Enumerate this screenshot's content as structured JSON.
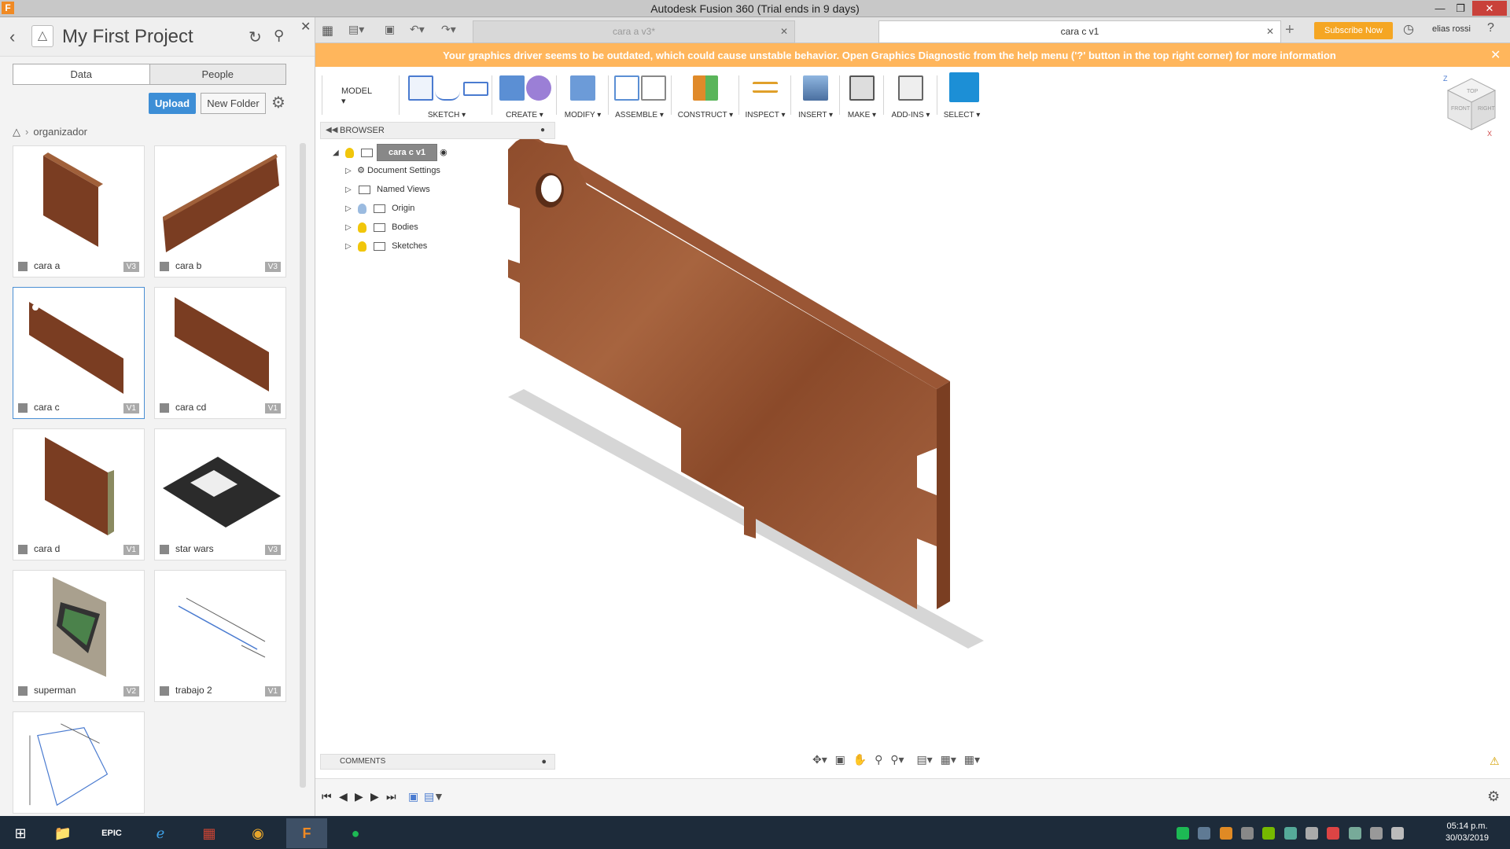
{
  "window": {
    "title": "Autodesk Fusion 360 (Trial ends in 9 days)",
    "app_icon": "F"
  },
  "data_panel": {
    "project_title": "My First Project",
    "tabs": [
      "Data",
      "People"
    ],
    "upload_label": "Upload",
    "new_folder_label": "New Folder",
    "breadcrumb": "organizador",
    "items": [
      {
        "name": "cara a",
        "version": "V3"
      },
      {
        "name": "cara b",
        "version": "V3"
      },
      {
        "name": "cara c",
        "version": "V1"
      },
      {
        "name": "cara cd",
        "version": "V1"
      },
      {
        "name": "cara d",
        "version": "V1"
      },
      {
        "name": "star wars",
        "version": "V3"
      },
      {
        "name": "superman",
        "version": "V2"
      },
      {
        "name": "trabajo 2",
        "version": "V1"
      },
      {
        "name": "",
        "version": ""
      }
    ]
  },
  "app_tabs": {
    "inactive_tab": "cara a v3*",
    "active_tab": "cara c v1",
    "subscribe": "Subscribe Now",
    "user": "elias rossi"
  },
  "banner": {
    "message": "Your graphics driver seems to be outdated, which could cause unstable behavior. Open Graphics Diagnostic from the help menu ('?' button in the top right corner) for more information"
  },
  "toolbar": {
    "workspace": "MODEL",
    "groups": [
      "SKETCH",
      "CREATE",
      "MODIFY",
      "ASSEMBLE",
      "CONSTRUCT",
      "INSPECT",
      "INSERT",
      "MAKE",
      "ADD-INS",
      "SELECT"
    ]
  },
  "browser": {
    "title": "BROWSER",
    "root": "cara c v1",
    "nodes": [
      "Document Settings",
      "Named Views",
      "Origin",
      "Bodies",
      "Sketches"
    ]
  },
  "comments_label": "COMMENTS",
  "viewcube": {
    "top": "TOP",
    "front": "FRONT",
    "right": "RIGHT",
    "axis_z": "Z",
    "axis_x": "X"
  },
  "taskbar": {
    "time": "05:14 p.m.",
    "date": "30/03/2019"
  },
  "colors": {
    "accent_blue": "#3d8ed6",
    "banner_orange": "#ffb65c",
    "subscribe_orange": "#f5a623",
    "wood": "#9b5a37"
  }
}
